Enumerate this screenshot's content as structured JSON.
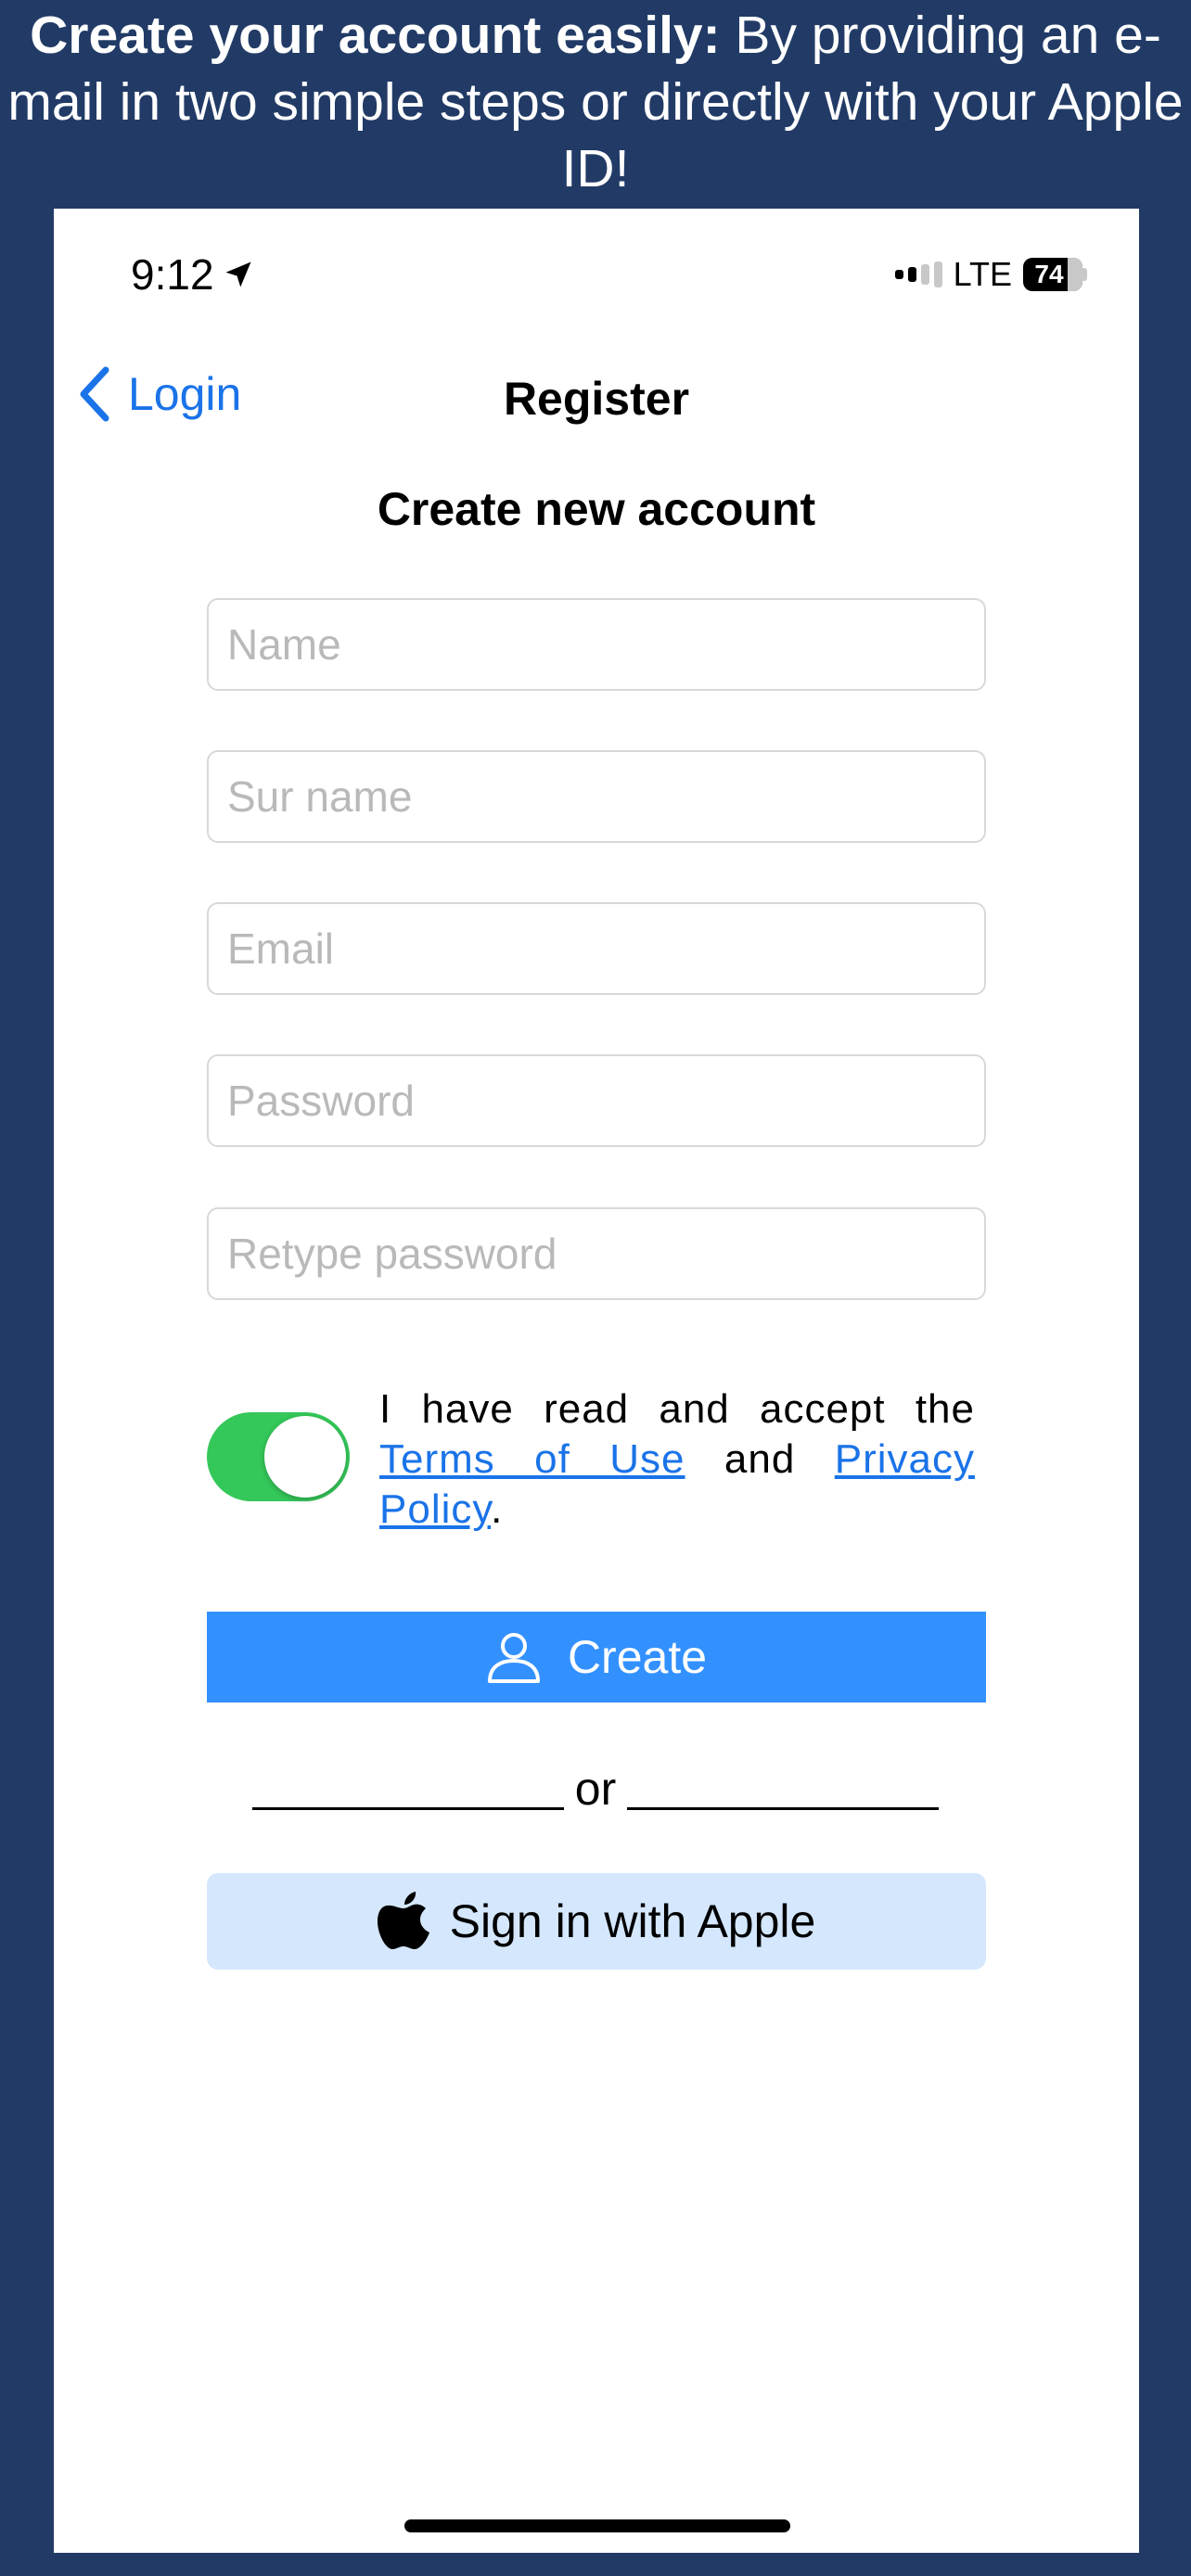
{
  "caption": {
    "bold": "Create your account easily:",
    "rest": " By providing an e-mail in two simple steps or directly with your Apple ID!"
  },
  "status_bar": {
    "time": "9:12",
    "network": "LTE",
    "battery": "74"
  },
  "nav": {
    "back_label": "Login",
    "title": "Register"
  },
  "heading": "Create new account",
  "fields": {
    "name_placeholder": "Name",
    "surname_placeholder": "Sur name",
    "email_placeholder": "Email",
    "password_placeholder": "Password",
    "retype_placeholder": "Retype password"
  },
  "terms": {
    "prefix": "I have read and accept the ",
    "terms_link": "Terms of Use",
    "middle": " and ",
    "privacy_link": "Privacy Policy",
    "suffix": ".",
    "accepted": true
  },
  "buttons": {
    "create_label": "Create",
    "or_label": "or",
    "apple_label": "Sign in with Apple"
  },
  "colors": {
    "background": "#223b66",
    "accent": "#1a73e8",
    "create_button": "#3391ff",
    "apple_button": "#d4e7fd",
    "toggle_on": "#34c759"
  },
  "icons": {
    "location": "location-arrow-icon",
    "back": "chevron-left-icon",
    "person": "person-icon",
    "apple": "apple-logo-icon"
  }
}
